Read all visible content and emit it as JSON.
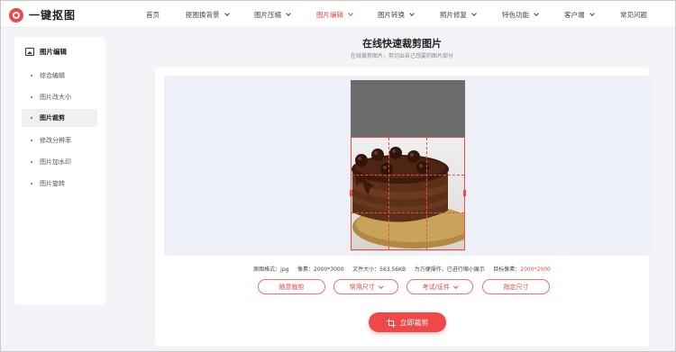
{
  "app": {
    "logo_text": "一键抠图"
  },
  "nav": {
    "items": [
      {
        "label": "首页",
        "has_dropdown": false,
        "active": false
      },
      {
        "label": "抠图换背景",
        "has_dropdown": true,
        "active": false
      },
      {
        "label": "图片压缩",
        "has_dropdown": true,
        "active": false
      },
      {
        "label": "图片编辑",
        "has_dropdown": true,
        "active": true
      },
      {
        "label": "图片转换",
        "has_dropdown": true,
        "active": false
      },
      {
        "label": "照片修复",
        "has_dropdown": true,
        "active": false
      },
      {
        "label": "特色功能",
        "has_dropdown": true,
        "active": false
      },
      {
        "label": "客户端",
        "has_dropdown": true,
        "active": false
      },
      {
        "label": "常见问题",
        "has_dropdown": false,
        "active": false
      }
    ]
  },
  "sidebar": {
    "title": "图片编辑",
    "items": [
      {
        "label": "综合编辑"
      },
      {
        "label": "图片改大小"
      },
      {
        "label": "图片裁剪",
        "active": true
      },
      {
        "label": "修改分辨率"
      },
      {
        "label": "图片加水印"
      },
      {
        "label": "图片旋转"
      }
    ]
  },
  "main": {
    "title": "在线快速裁剪图片",
    "subtitle": "在线裁剪图片，剪切出自己想要的图片部分"
  },
  "info": {
    "format_label": "原图格式：",
    "format_value": "jpg",
    "pixels_label": "像素：",
    "pixels_value": "2000*3000",
    "size_label": "文件大小：",
    "size_value": "563.56KB",
    "note": "为方便操作，已进行缩小展示",
    "target_label": "目标像素：",
    "target_value": "2000*2000"
  },
  "options": {
    "free_crop": "随意裁剪",
    "common_size": "常用尺寸",
    "exam_cert": "考试/证件",
    "custom_size": "指定尺寸"
  },
  "action": {
    "crop_now": "立即裁剪"
  },
  "colors": {
    "accent": "#f04848",
    "background": "#f3f4f8",
    "editor_bg": "#edf0f6"
  }
}
